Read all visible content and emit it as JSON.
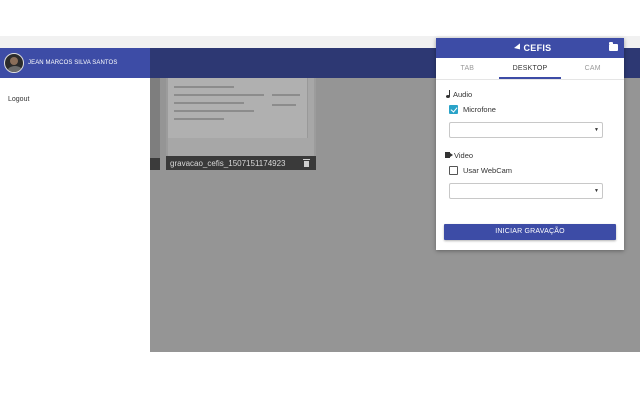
{
  "sidebar": {
    "user_name": "JEAN MARCOS SILVA SANTOS",
    "logout_label": "Logout"
  },
  "recordings": [
    {
      "file_name": "gravacao_cefis_1507151174923"
    }
  ],
  "panel": {
    "brand": "CEFIS",
    "tabs": [
      {
        "label": "TAB"
      },
      {
        "label": "DESKTOP"
      },
      {
        "label": "CAM"
      }
    ],
    "active_tab": "DESKTOP",
    "audio": {
      "title": "Audio",
      "mic_label": "Microfone",
      "mic_checked": true,
      "selected_device": ""
    },
    "video": {
      "title": "Video",
      "webcam_label": "Usar WebCam",
      "webcam_checked": false,
      "selected_device": ""
    },
    "start_label": "INICIAR GRAVAÇÃO"
  },
  "colors": {
    "brand": "#3d4ca6",
    "header_dark": "#2d3873",
    "checkbox_accent": "#2aa3c8"
  }
}
